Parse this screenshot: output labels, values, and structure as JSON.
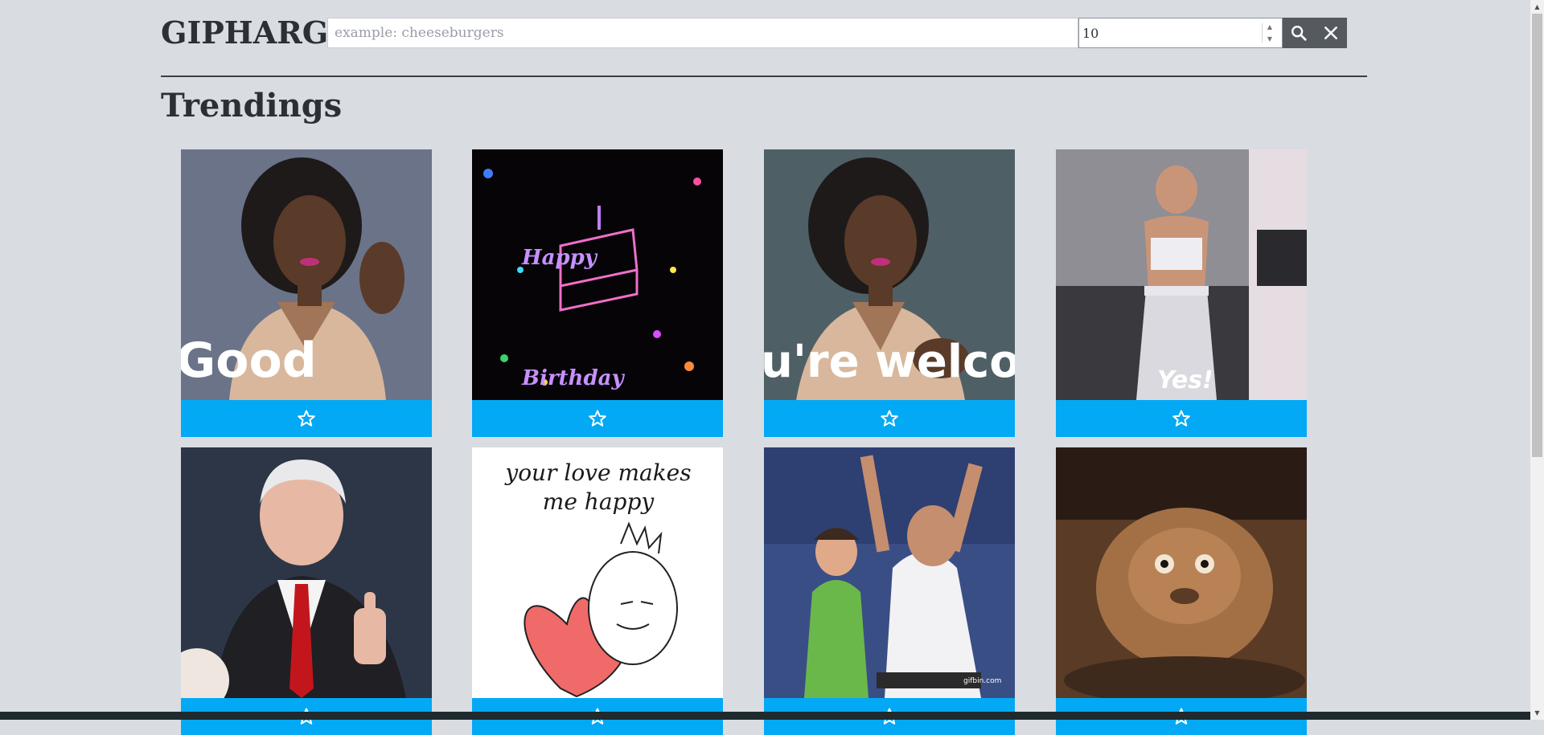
{
  "app": {
    "brand": "GIPHARG"
  },
  "search": {
    "placeholder": "example: cheeseburgers",
    "value": "",
    "limit_value": "10"
  },
  "buttons": {
    "search_icon": "search-icon",
    "clear_icon": "close-icon"
  },
  "section": {
    "title": "Trendings"
  },
  "gifs": [
    {
      "caption": "Good",
      "favorite_icon": "star-outline-icon"
    },
    {
      "caption": "Happy Birthday",
      "favorite_icon": "star-outline-icon"
    },
    {
      "caption": "u're welco",
      "favorite_icon": "star-outline-icon"
    },
    {
      "caption": "Yes!",
      "favorite_icon": "star-outline-icon"
    },
    {
      "caption": "",
      "favorite_icon": "star-outline-icon"
    },
    {
      "caption": "your love makes me happy",
      "favorite_icon": "star-outline-icon"
    },
    {
      "caption": "gifbin.com",
      "favorite_icon": "star-outline-icon"
    },
    {
      "caption": "",
      "favorite_icon": "star-outline-icon"
    }
  ],
  "colors": {
    "background": "#d9dce1",
    "favorite_bar": "#03a9f4",
    "button": "#555a61",
    "text": "#2b2f36"
  }
}
